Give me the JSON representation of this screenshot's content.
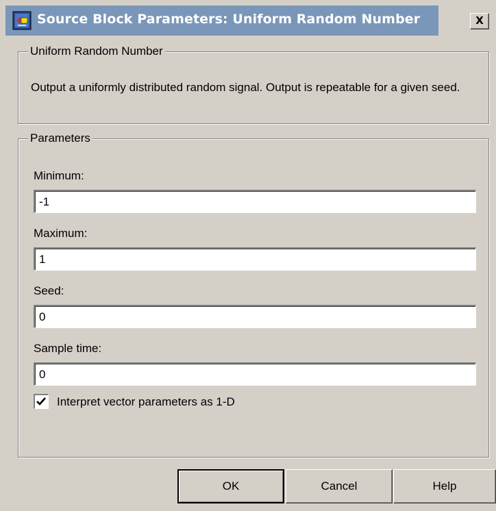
{
  "window": {
    "title": "Source Block Parameters: Uniform Random Number",
    "close_glyph": "X"
  },
  "block_group": {
    "legend": "Uniform Random Number",
    "description": "Output a uniformly distributed random signal.  Output is repeatable for a given seed."
  },
  "parameters": {
    "legend": "Parameters",
    "minimum_label": "Minimum:",
    "minimum_value": "-1",
    "maximum_label": "Maximum:",
    "maximum_value": "1",
    "seed_label": "Seed:",
    "seed_value": "0",
    "sample_time_label": "Sample time:",
    "sample_time_value": "0",
    "interpret_label": "Interpret vector parameters as 1-D",
    "interpret_checked": true
  },
  "buttons": {
    "ok": "OK",
    "cancel": "Cancel",
    "help": "Help"
  },
  "icons": {
    "title_icon": "simulink-block-icon",
    "check_icon": "checkmark-icon"
  }
}
